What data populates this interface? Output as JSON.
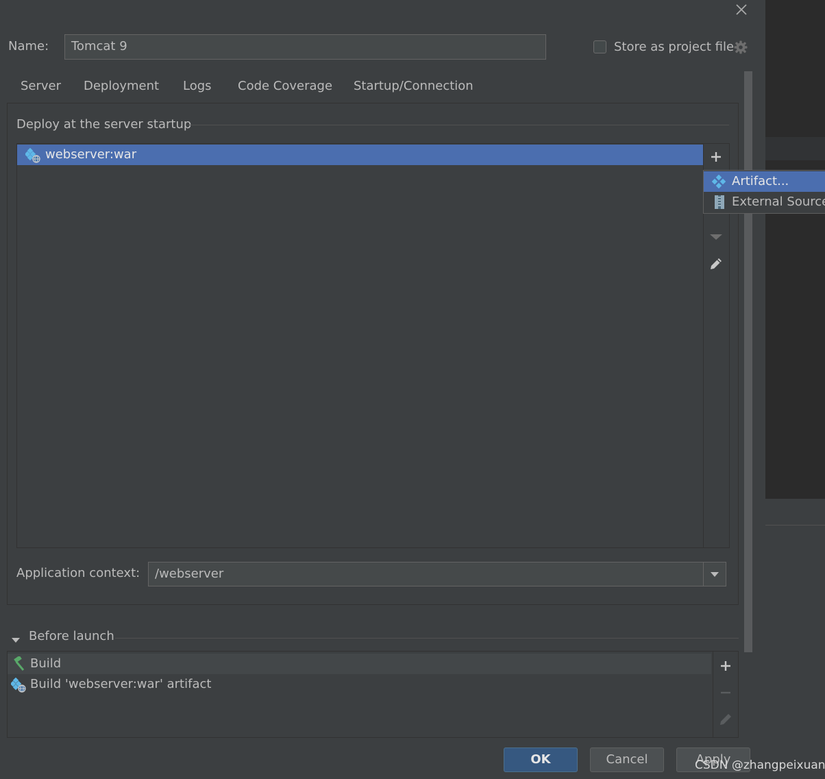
{
  "dialog": {
    "name_label": "Name:",
    "name_value": "Tomcat 9",
    "store_label": "Store as project file"
  },
  "tabs": [
    {
      "label": "Server"
    },
    {
      "label": "Deployment"
    },
    {
      "label": "Logs"
    },
    {
      "label": "Code Coverage"
    },
    {
      "label": "Startup/Connection"
    }
  ],
  "deployment": {
    "section_title": "Deploy at the server startup",
    "items": [
      "webserver:war"
    ],
    "app_context_label": "Application context:",
    "app_context_value": "/webserver"
  },
  "add_menu": {
    "items": [
      "Artifact...",
      "External Source..."
    ]
  },
  "before_launch": {
    "title": "Before launch",
    "items": [
      "Build",
      "Build 'webserver:war' artifact"
    ]
  },
  "buttons": {
    "ok": "OK",
    "cancel": "Cancel",
    "apply": "Apply"
  },
  "watermark": "CSDN @zhangpeixuan",
  "colors": {
    "background": "#3c3f41",
    "selection": "#4b6eaf",
    "tab_underline": "#4a88c7",
    "default_button": "#365880"
  }
}
